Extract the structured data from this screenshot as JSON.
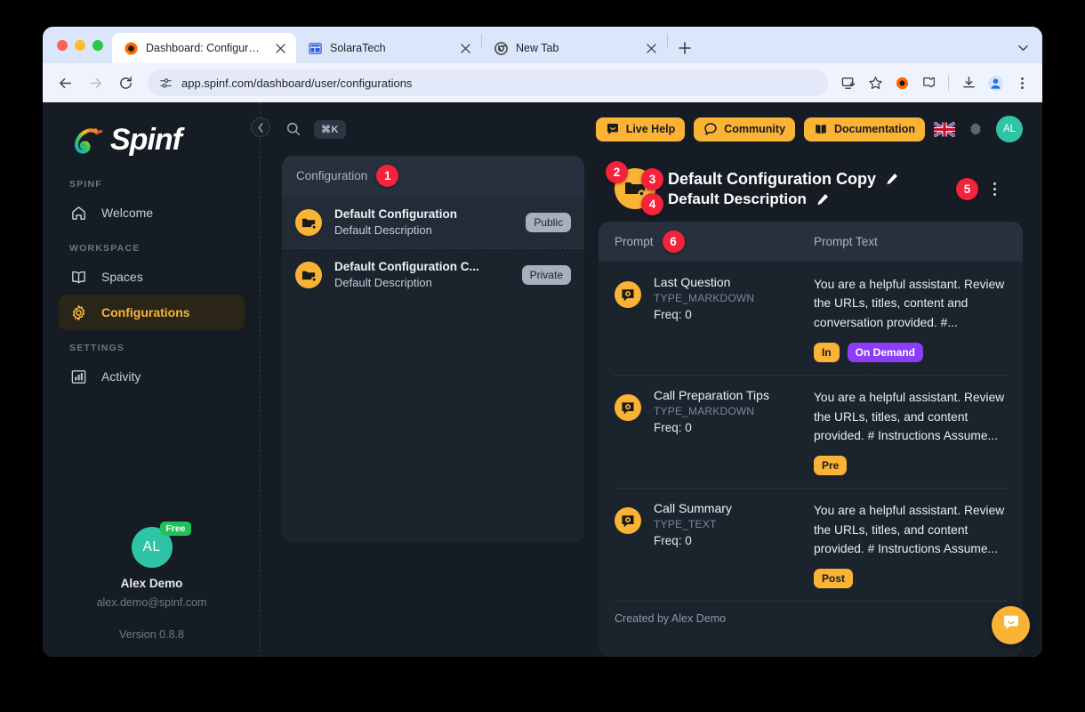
{
  "browser": {
    "tabs": [
      {
        "title": "Dashboard: Configuration",
        "favicon": "record-icon",
        "active": true
      },
      {
        "title": "SolaraTech",
        "favicon": "window-grid-icon",
        "active": false
      },
      {
        "title": "New Tab",
        "favicon": "chrome-icon",
        "active": false
      }
    ],
    "new_tab_label": "+",
    "url": "app.spinf.com/dashboard/user/configurations",
    "toolbar_icons": [
      "back-icon",
      "forward-icon",
      "reload-icon",
      "site-settings-icon",
      "install-app-icon",
      "bookmark-star-icon",
      "record-extension-icon",
      "extensions-icon",
      "downloads-icon",
      "profile-icon",
      "chrome-menu-icon"
    ]
  },
  "sidebar": {
    "brand": "Spinf",
    "sections": [
      {
        "label": "SPINF",
        "items": [
          {
            "label": "Welcome",
            "icon": "home-icon",
            "active": false
          }
        ]
      },
      {
        "label": "WORKSPACE",
        "items": [
          {
            "label": "Spaces",
            "icon": "book-icon",
            "active": false
          },
          {
            "label": "Configurations",
            "icon": "gear-icon",
            "active": true
          }
        ]
      },
      {
        "label": "SETTINGS",
        "items": [
          {
            "label": "Activity",
            "icon": "bar-chart-icon",
            "active": false
          }
        ]
      }
    ],
    "user": {
      "initials": "AL",
      "plan": "Free",
      "name": "Alex Demo",
      "email": "alex.demo@spinf.com"
    },
    "version": "Version 0.8.8"
  },
  "topbar": {
    "search_shortcut": "⌘K",
    "buttons": [
      {
        "label": "Live Help",
        "icon": "chat-smile-icon"
      },
      {
        "label": "Community",
        "icon": "chat-bubble-icon"
      },
      {
        "label": "Documentation",
        "icon": "book-open-icon"
      }
    ],
    "flag": "uk-flag-icon",
    "avatar_initials": "AL"
  },
  "list_panel": {
    "header": "Configuration",
    "marker": "1",
    "rows": [
      {
        "title": "Default Configuration",
        "description": "Default Description",
        "badge": "Public",
        "selected": true
      },
      {
        "title": "Default Configuration C...",
        "description": "Default Description",
        "badge": "Private",
        "selected": false
      }
    ]
  },
  "detail": {
    "marker_avatar": "2",
    "marker_title": "3",
    "marker_subtitle": "4",
    "marker_menu": "5",
    "title": "Default Configuration Copy",
    "subtitle": "Default Description",
    "footer": "Created by Alex Demo"
  },
  "prompt_table": {
    "marker": "6",
    "columns": {
      "prompt": "Prompt",
      "prompt_text": "Prompt Text"
    },
    "rows": [
      {
        "name": "Last Question",
        "type": "TYPE_MARKDOWN",
        "freq": "Freq: 0",
        "text": "You are a helpful assistant. Review the URLs, titles, content and conversation provided. #...",
        "tags": [
          {
            "label": "In",
            "style": "amber"
          },
          {
            "label": "On Demand",
            "style": "purple"
          }
        ]
      },
      {
        "name": "Call Preparation Tips",
        "type": "TYPE_MARKDOWN",
        "freq": "Freq: 0",
        "text": "You are a helpful assistant. Review the URLs, titles, and content provided. # Instructions Assume...",
        "tags": [
          {
            "label": "Pre",
            "style": "amber"
          }
        ]
      },
      {
        "name": "Call Summary",
        "type": "TYPE_TEXT",
        "freq": "Freq: 0",
        "text": "You are a helpful assistant. Review the URLs, titles, and content provided. # Instructions Assume...",
        "tags": [
          {
            "label": "Post",
            "style": "amber"
          }
        ]
      }
    ]
  },
  "colors": {
    "accent_amber": "#fbb336",
    "marker_red": "#f5223c",
    "tag_purple": "#8b3dfa",
    "avatar_teal": "#2ec4a5",
    "plan_green": "#1fc15a",
    "app_bg": "#151c24",
    "panel_bg": "#1b232d",
    "panel_head_bg": "#26313d"
  }
}
